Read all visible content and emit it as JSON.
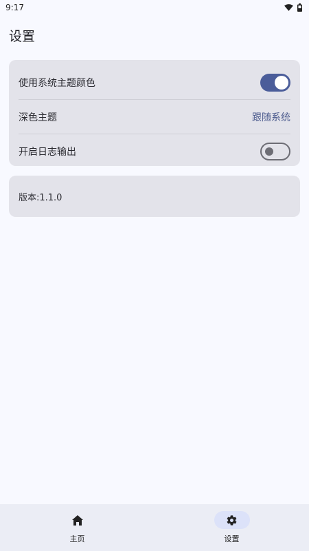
{
  "status": {
    "time": "9:17"
  },
  "page": {
    "title": "设置"
  },
  "settings": {
    "use_system_theme_color": {
      "label": "使用系统主题颜色",
      "enabled": true
    },
    "dark_theme": {
      "label": "深色主题",
      "value": "跟随系统"
    },
    "enable_log_output": {
      "label": "开启日志输出",
      "enabled": false
    }
  },
  "version": {
    "text": "版本:1.1.0"
  },
  "nav": {
    "items": [
      {
        "label": "主页",
        "icon": "home-icon",
        "active": false
      },
      {
        "label": "设置",
        "icon": "gear-icon",
        "active": true
      }
    ]
  },
  "colors": {
    "accent": "#4b5d9a",
    "link": "#4b5a8d",
    "card_bg": "#e3e3ea",
    "page_bg": "#f8f9ff"
  }
}
